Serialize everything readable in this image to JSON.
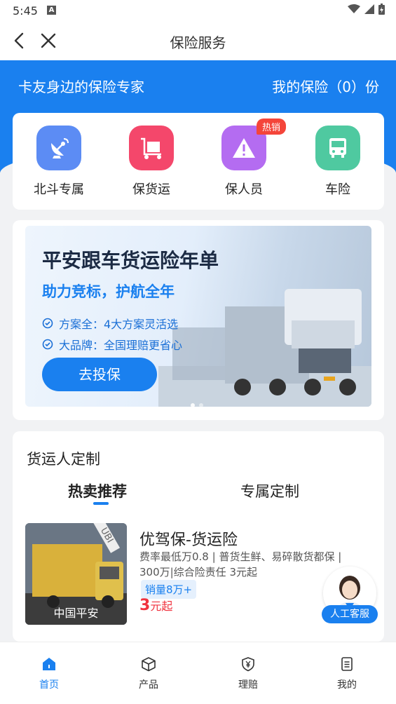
{
  "status": {
    "time": "5:45",
    "notif_icon": "A"
  },
  "nav": {
    "title": "保险服务"
  },
  "header": {
    "slogan": "卡友身边的保险专家",
    "my_insurance": "我的保险（0）份"
  },
  "categories": [
    {
      "label": "北斗专属",
      "icon": "satellite-dish-icon",
      "color": "#5c8cf4"
    },
    {
      "label": "保货运",
      "icon": "cart-icon",
      "color": "#f4476b"
    },
    {
      "label": "保人员",
      "icon": "warning-icon",
      "color": "#b46cf1",
      "badge": "热销"
    },
    {
      "label": "车险",
      "icon": "bus-icon",
      "color": "#4fc9a0"
    }
  ],
  "banner": {
    "title": "平安跟车货运险年单",
    "subtitle": "助力竞标，护航全年",
    "features": [
      "方案全：4大方案灵活选",
      "大品牌：全国理赔更省心"
    ],
    "cta": "去投保"
  },
  "section": {
    "title": "货运人定制",
    "tabs": [
      "热卖推荐",
      "专属定制"
    ],
    "active_tab": 0
  },
  "product": {
    "name": "优驾保-货运险",
    "desc": "费率最低万0.8 | 普货生鲜、易碎散货都保 | 300万|综合险责任 3元起",
    "sales": "销量8万+",
    "price_num": "3",
    "price_unit": "元起",
    "image_tag": "UBI",
    "image_brand": "中国平安"
  },
  "service": {
    "label": "人工客服"
  },
  "tabbar": [
    {
      "label": "首页",
      "icon": "home-icon"
    },
    {
      "label": "产品",
      "icon": "cube-icon"
    },
    {
      "label": "理赔",
      "icon": "shield-yen-icon"
    },
    {
      "label": "我的",
      "icon": "document-icon"
    }
  ],
  "colors": {
    "primary": "#1a80ef",
    "price": "#f0333f",
    "hot_badge": "#f4453a"
  }
}
